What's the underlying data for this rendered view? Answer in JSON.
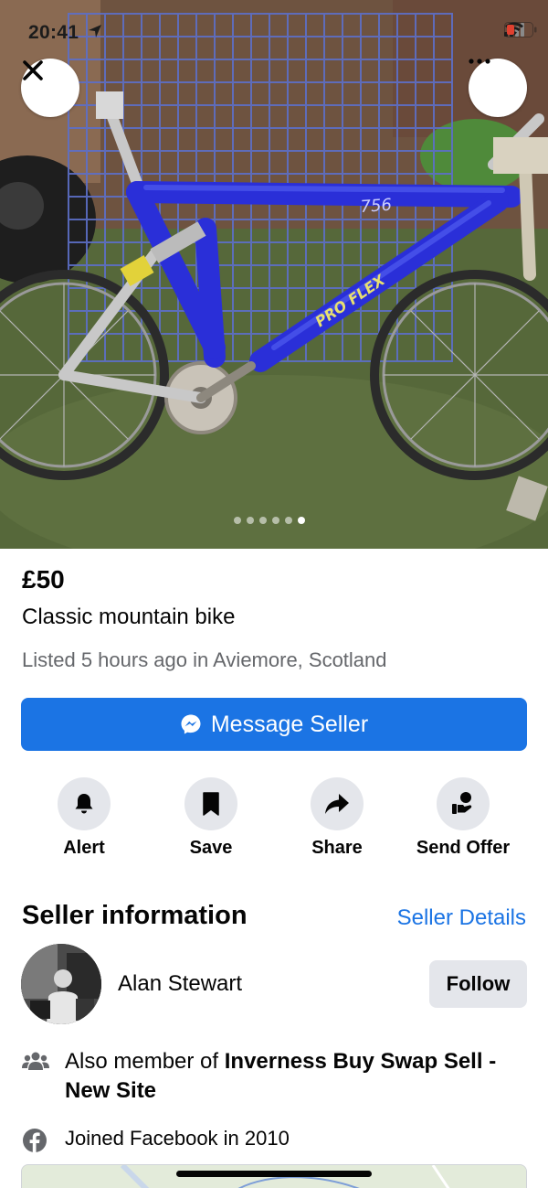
{
  "status_bar": {
    "time": "20:41",
    "location_icon": "location-arrow-icon",
    "signal_icon": "signal-icon",
    "wifi_icon": "wifi-icon",
    "battery_icon": "battery-low-icon",
    "battery_color": "#e0402f"
  },
  "photo": {
    "image_count": 6,
    "active_index": 5,
    "close_icon": "close-icon",
    "more_icon": "more-horizontal-icon"
  },
  "listing": {
    "price": "£50",
    "title": "Classic mountain bike",
    "meta": "Listed 5 hours ago in Aviemore, Scotland"
  },
  "message_button": {
    "label": "Message Seller",
    "icon": "messenger-icon",
    "color": "#1b74e4"
  },
  "actions": [
    {
      "label": "Alert",
      "icon": "bell-icon"
    },
    {
      "label": "Save",
      "icon": "bookmark-icon"
    },
    {
      "label": "Share",
      "icon": "share-arrow-icon"
    },
    {
      "label": "Send Offer",
      "icon": "offer-hand-icon"
    }
  ],
  "seller": {
    "heading": "Seller information",
    "details_link": "Seller Details",
    "name": "Alan Stewart",
    "follow_label": "Follow",
    "member_prefix": "Also member of ",
    "member_group": "Inverness Buy Swap Sell - New Site",
    "joined": "Joined Facebook in 2010"
  }
}
